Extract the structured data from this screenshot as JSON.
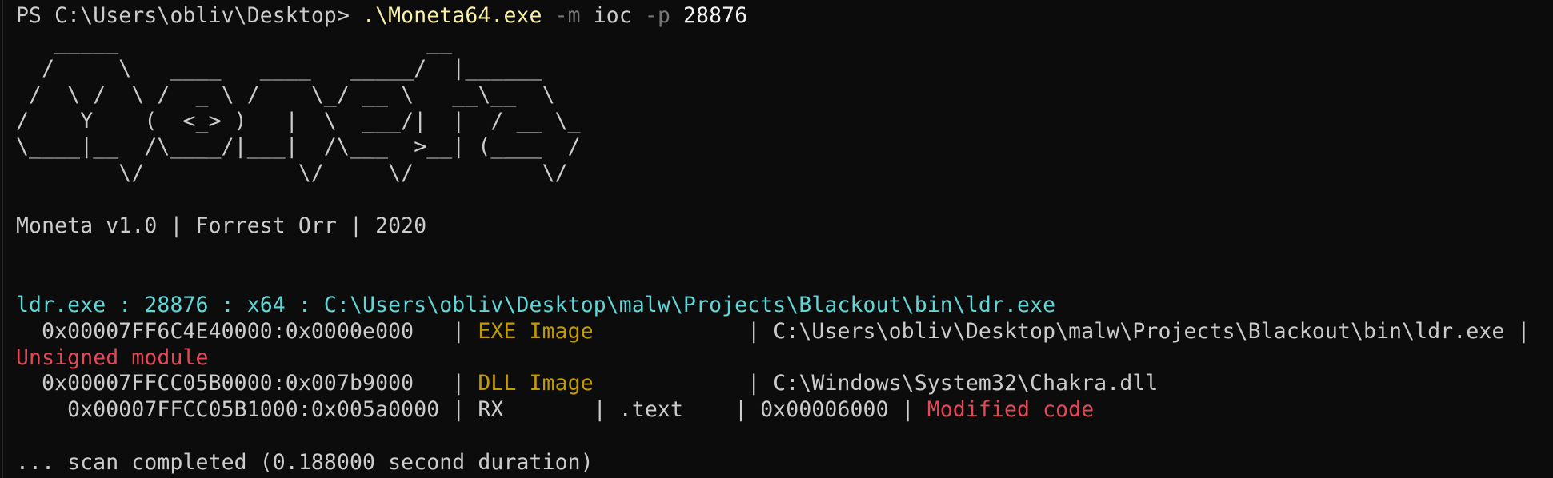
{
  "colors": {
    "background": "#0c0c0c",
    "default": "#cccccc",
    "yellow": "#f9f1a5",
    "gray": "#767676",
    "white": "#f2f2f2",
    "cyan": "#61d6d6",
    "dkyellow": "#c19c00",
    "red": "#e74856"
  },
  "lines": [
    {
      "name": "command-line",
      "segs": [
        {
          "t": "PS C:\\Users\\obliv\\Desktop> ",
          "c": "def"
        },
        {
          "t": ".\\Moneta64.exe",
          "c": "yellow"
        },
        {
          "t": " -m",
          "c": "gray"
        },
        {
          "t": " ioc",
          "c": "def"
        },
        {
          "t": " -p",
          "c": "gray"
        },
        {
          "t": " 28876",
          "c": "white"
        }
      ]
    },
    {
      "name": "banner-art-line",
      "segs": [
        {
          "t": "   _____                        __",
          "c": "def"
        }
      ]
    },
    {
      "name": "banner-art-line",
      "segs": [
        {
          "t": "  /     \\   ____   ____   _____/  |______",
          "c": "def"
        }
      ]
    },
    {
      "name": "banner-art-line",
      "segs": [
        {
          "t": " /  \\ /  \\ /  _ \\ /    \\_/ __ \\   __\\__  \\",
          "c": "def"
        }
      ]
    },
    {
      "name": "banner-art-line",
      "segs": [
        {
          "t": "/    Y    (  <_> )   |  \\  ___/|  |  / __ \\_",
          "c": "def"
        }
      ]
    },
    {
      "name": "banner-art-line",
      "segs": [
        {
          "t": "\\____|__  /\\____/|___|  /\\___  >__| (____  /",
          "c": "def"
        }
      ]
    },
    {
      "name": "banner-art-line",
      "segs": [
        {
          "t": "        \\/            \\/     \\/          \\/",
          "c": "def"
        }
      ]
    },
    {
      "name": "blank-line",
      "segs": []
    },
    {
      "name": "version-line",
      "segs": [
        {
          "t": "Moneta v1.0 | Forrest Orr | 2020",
          "c": "def"
        }
      ]
    },
    {
      "name": "blank-line",
      "segs": []
    },
    {
      "name": "blank-line",
      "segs": []
    },
    {
      "name": "process-header",
      "segs": [
        {
          "t": "ldr.exe : 28876 : x64 : C:\\Users\\obliv\\Desktop\\malw\\Projects\\Blackout\\bin\\ldr.exe",
          "c": "cyan"
        }
      ]
    },
    {
      "name": "region-row-exe",
      "segs": [
        {
          "t": "  0x00007FF6C4E40000:0x0000e000   | ",
          "c": "def"
        },
        {
          "t": "EXE Image",
          "c": "dkyellow"
        },
        {
          "t": "            | C:\\Users\\obliv\\Desktop\\malw\\Projects\\Blackout\\bin\\ldr.exe |",
          "c": "def"
        }
      ]
    },
    {
      "name": "ioc-unsigned",
      "segs": [
        {
          "t": "Unsigned module",
          "c": "red"
        }
      ]
    },
    {
      "name": "region-row-dll",
      "segs": [
        {
          "t": "  0x00007FFCC05B0000:0x007b9000   | ",
          "c": "def"
        },
        {
          "t": "DLL Image",
          "c": "dkyellow"
        },
        {
          "t": "            | C:\\Windows\\System32\\Chakra.dll",
          "c": "def"
        }
      ]
    },
    {
      "name": "subregion-row",
      "segs": [
        {
          "t": "    0x00007FFCC05B1000:0x005a0000 | RX       | .text    | 0x00006000 | ",
          "c": "def"
        },
        {
          "t": "Modified code",
          "c": "red"
        }
      ]
    },
    {
      "name": "blank-line",
      "segs": []
    },
    {
      "name": "scan-complete-line",
      "segs": [
        {
          "t": "... scan completed (0.188000 second duration)",
          "c": "def"
        }
      ]
    }
  ]
}
